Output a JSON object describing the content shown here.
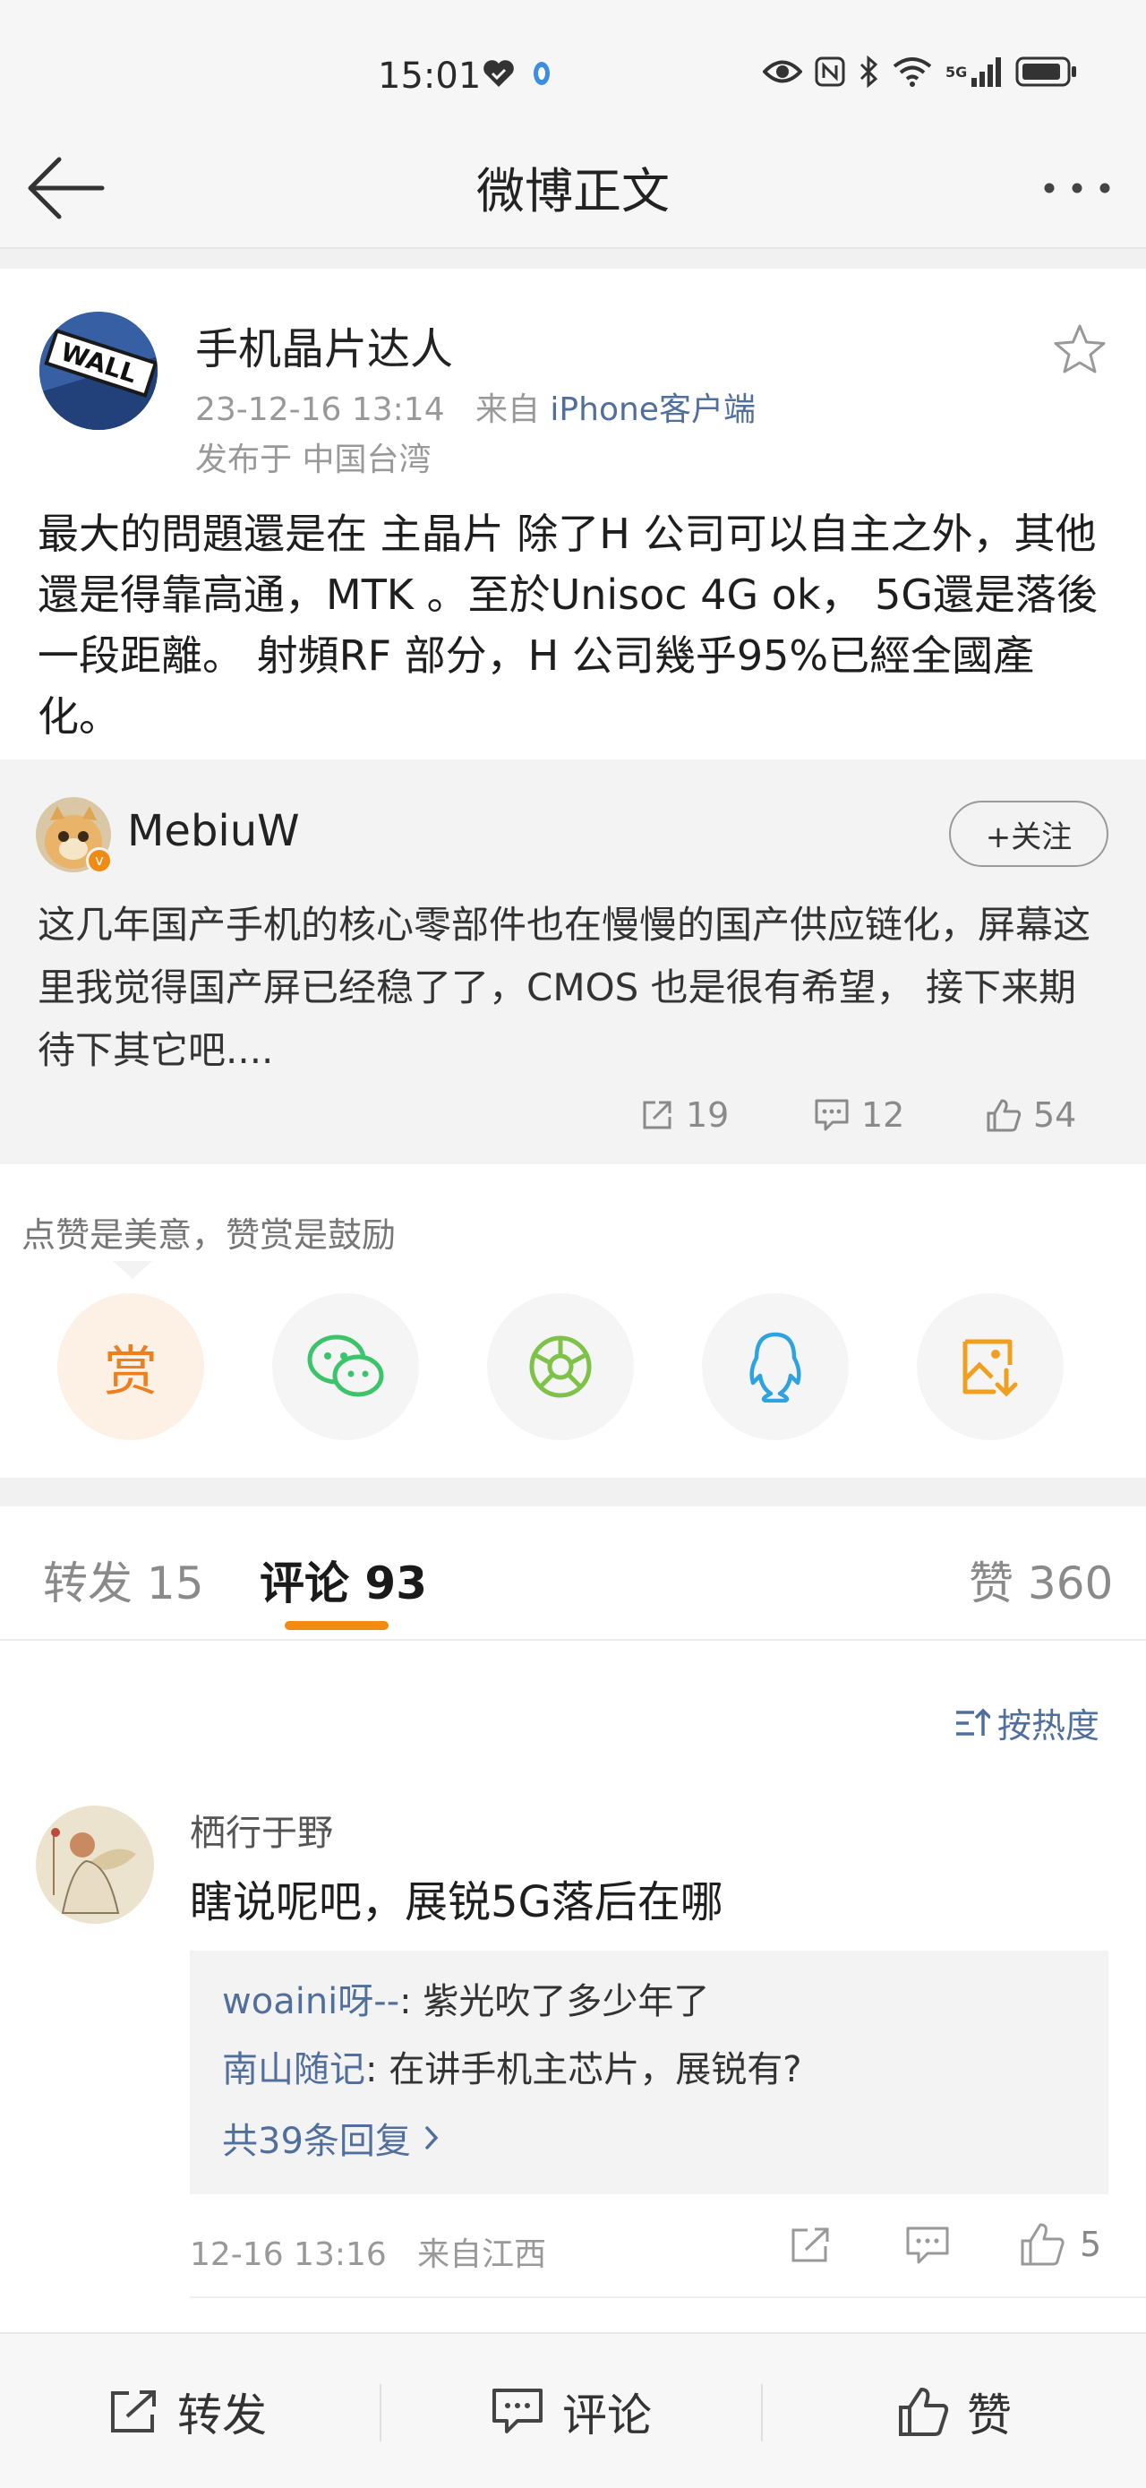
{
  "status_bar": {
    "time": "15:01",
    "network": "5G",
    "icons": [
      "heart-shield-icon",
      "location-dot-icon",
      "eye-icon",
      "nfc-icon",
      "bluetooth-icon",
      "wifi-icon",
      "signal-icon",
      "battery-icon"
    ]
  },
  "nav": {
    "title": "微博正文",
    "back_icon": "arrow-left-icon",
    "more_icon": "more-horizontal-icon"
  },
  "post": {
    "author": "手机晶片达人",
    "datetime": "23-12-16 13:14",
    "source_prefix": "来自",
    "source": "iPhone客户端",
    "location": "发布于 中国台湾",
    "body": "最大的問題還是在 主晶片 除了H 公司可以自主之外，其他還是得靠高通，MTK 。至於Unisoc 4G ok， 5G還是落後一段距離。 射頻RF 部分，H 公司幾乎95%已經全國產化。"
  },
  "quoted": {
    "author": "MebiuW",
    "follow_label": "+关注",
    "body": "这几年国产手机的核心零部件也在慢慢的国产供应链化，屏幕这里我觉得国产屏已经稳了了，CMOS 也是很有希望， 接下来期待下其它吧....",
    "reposts": "19",
    "comments": "12",
    "likes": "54"
  },
  "reward": {
    "tip": "点赞是美意，赞赏是鼓励",
    "reward_label": "赏",
    "share_targets": [
      "wechat-icon",
      "moments-icon",
      "qq-icon",
      "save-image-icon"
    ]
  },
  "tabs": {
    "repost": "转发 15",
    "comment": "评论 93",
    "like": "赞 360",
    "sort_label": "按热度"
  },
  "comment": {
    "author": "栖行于野",
    "text": "瞎说呢吧，展锐5G落后在哪",
    "replies": [
      {
        "name": "woaini呀--",
        "text": ": 紫光吹了多少年了"
      },
      {
        "name": "南山随记",
        "text": ": 在讲手机主芯片，展锐有?"
      }
    ],
    "more_replies": "共39条回复",
    "time": "12-16 13:16",
    "location": "来自江西",
    "likes": "5"
  },
  "bottom_bar": {
    "repost": "转发",
    "comment": "评论",
    "like": "赞"
  },
  "colors": {
    "accent_orange": "#f08b14",
    "link_blue": "#506f9c",
    "wechat_green": "#3cc46a",
    "moments_green": "#7fc24a",
    "qq_blue": "#2fa2e0"
  }
}
